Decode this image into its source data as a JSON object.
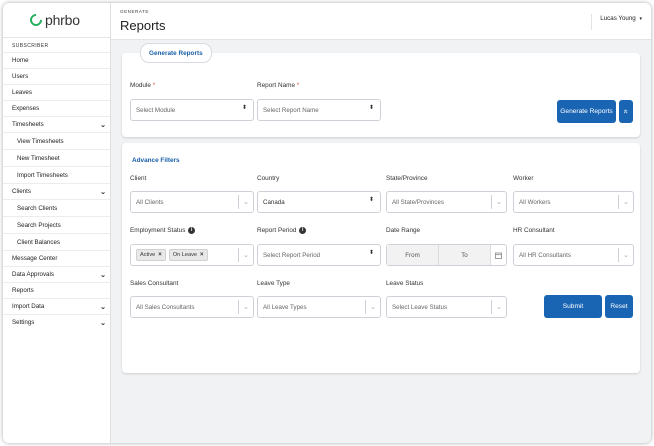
{
  "sidebar": {
    "logo_text": "phrbo",
    "section_label": "SUBSCRIBER",
    "items": [
      {
        "label": "Home"
      },
      {
        "label": "Users"
      },
      {
        "label": "Leaves"
      },
      {
        "label": "Expenses"
      },
      {
        "label": "Timesheets",
        "chevron": "⌄"
      },
      {
        "label": "View Timesheets"
      },
      {
        "label": "New Timesheet"
      },
      {
        "label": "Import Timesheets"
      },
      {
        "label": "Clients",
        "chevron": "⌄"
      },
      {
        "label": "Search Clients"
      },
      {
        "label": "Search Projects"
      },
      {
        "label": "Client Balances"
      },
      {
        "label": "Message Center"
      },
      {
        "label": "Data Approvals",
        "chevron": "⌄"
      },
      {
        "label": "Reports"
      },
      {
        "label": "Import Data",
        "chevron": "⌄"
      },
      {
        "label": "Settings",
        "chevron": "⌄"
      }
    ]
  },
  "header": {
    "section": "GENERATE",
    "title": "Reports",
    "user": "Lucas Young",
    "user_caret": "▾"
  },
  "generate": {
    "tab_label": "Generate Reports",
    "module_label": "Module",
    "module_placeholder": "Select Module",
    "report_name_label": "Report Name",
    "report_name_placeholder": "Select Report Name",
    "required_mark": "*",
    "generate_button": "Generate Reports",
    "collapse_icon": "«"
  },
  "filters": {
    "title": "Advance Filters",
    "client_label": "Client",
    "client_value": "All Clients",
    "country_label": "Country",
    "country_value": "Canada",
    "state_label": "State/Province",
    "state_value": "All State/Provinces",
    "worker_label": "Worker",
    "worker_value": "All Workers",
    "employment_label": "Employment Status",
    "employment_chips": [
      "Active",
      "On Leave"
    ],
    "chip_remove": "×",
    "report_period_label": "Report Period",
    "report_period_value": "Select Report Period",
    "date_range_label": "Date Range",
    "date_from": "From",
    "date_to": "To",
    "hr_label": "HR Consultant",
    "hr_value": "All HR Consultants",
    "sales_label": "Sales Consultant",
    "sales_value": "All Sales Consultants",
    "leave_type_label": "Leave Type",
    "leave_type_value": "All Leave Types",
    "leave_status_label": "Leave Status",
    "leave_status_value": "Select Leave Status",
    "submit_button": "Submit",
    "reset_button": "Reset",
    "info_icon": "i",
    "dropdown_chevron": "⌄",
    "select_arrows": "⬍"
  }
}
